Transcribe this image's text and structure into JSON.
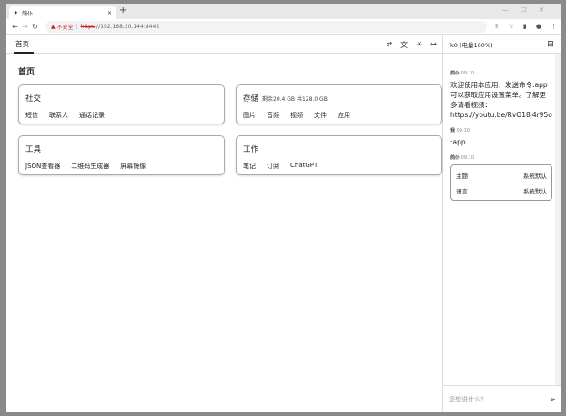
{
  "browser": {
    "tab_title": "鸽仆",
    "insecure_label": "不安全",
    "url_scheme": "https",
    "url_rest": "://192.168.20.144:8443"
  },
  "app": {
    "nav_tab": "首页",
    "page_title": "首页",
    "cards": [
      {
        "title": "社交",
        "subtitle": "",
        "links": [
          "短信",
          "联系人",
          "通话记录"
        ]
      },
      {
        "title": "存储",
        "subtitle": "剩余20.4 GB 共128.0 GB",
        "links": [
          "图片",
          "音频",
          "视频",
          "文件",
          "应用"
        ]
      },
      {
        "title": "工具",
        "subtitle": "",
        "links": [
          "JSON查看器",
          "二维码生成器",
          "屏幕镜像"
        ]
      },
      {
        "title": "工作",
        "subtitle": "",
        "links": [
          "笔记",
          "订阅",
          "ChatGPT"
        ]
      }
    ]
  },
  "chat": {
    "header": "k0 (电量100%)",
    "messages": [
      {
        "sender": "鸽仆",
        "time": "09:10",
        "text": "欢迎使用本应用，发送命令:app可以获取应用设置菜单。了解更多请看视频：https://youtu.be/RvO18j4r95o"
      },
      {
        "sender": "我",
        "time": "09:10",
        "text": ":app"
      },
      {
        "sender": "鸽仆",
        "time": "09:10"
      }
    ],
    "menu": [
      {
        "label": "主题",
        "value": "系统默认"
      },
      {
        "label": "语言",
        "value": "系统默认"
      }
    ],
    "input_placeholder": "您想说什么?"
  }
}
